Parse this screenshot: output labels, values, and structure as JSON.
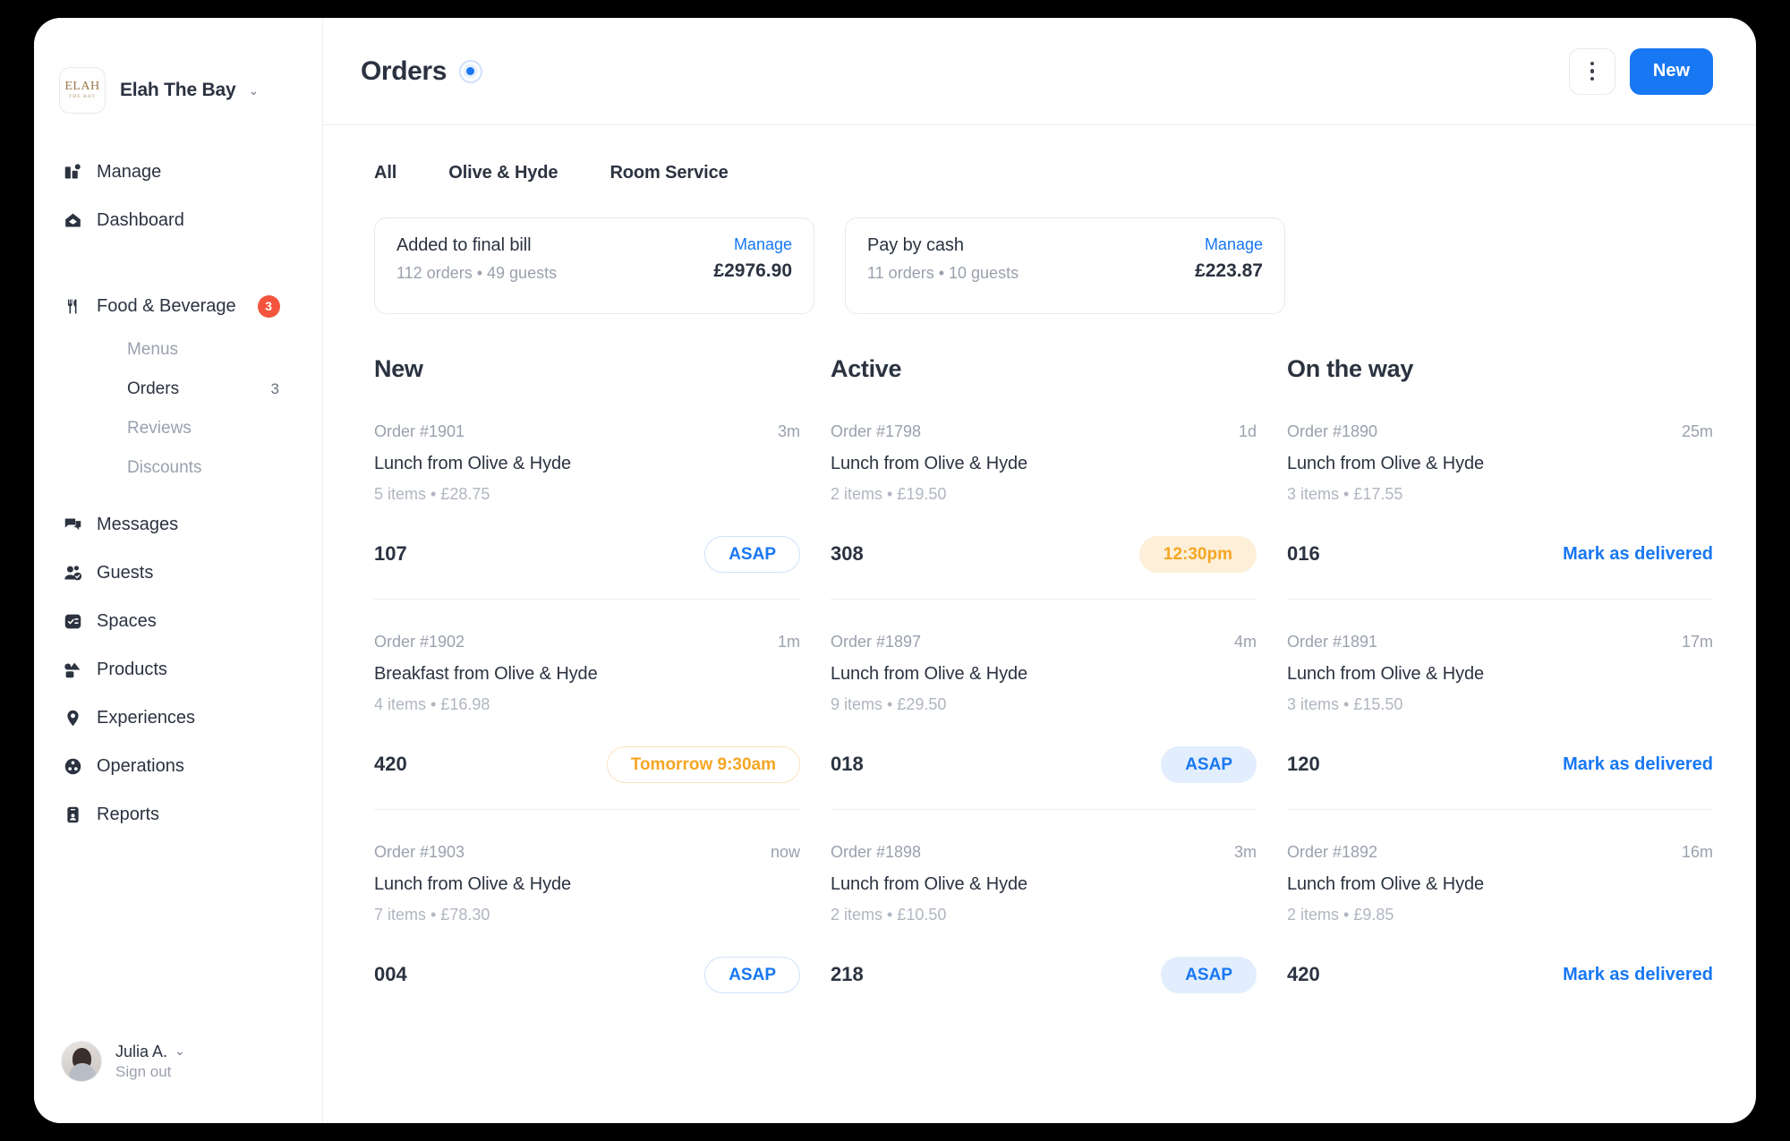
{
  "brand": {
    "logo_line1": "ELAH",
    "logo_line2": "THE BAY",
    "name": "Elah The Bay",
    "chevron": "⌄"
  },
  "sidebar": {
    "items": [
      {
        "label": "Manage",
        "icon": "manage-icon"
      },
      {
        "label": "Dashboard",
        "icon": "home-icon"
      }
    ],
    "food_beverage": {
      "label": "Food & Beverage",
      "icon": "cutlery-icon",
      "badge": "3"
    },
    "sub_items": [
      {
        "label": "Menus",
        "count": ""
      },
      {
        "label": "Orders",
        "count": "3"
      },
      {
        "label": "Reviews",
        "count": ""
      },
      {
        "label": "Discounts",
        "count": ""
      }
    ],
    "lower_items": [
      {
        "label": "Messages",
        "icon": "chat-icon"
      },
      {
        "label": "Guests",
        "icon": "users-check-icon"
      },
      {
        "label": "Spaces",
        "icon": "spaces-icon"
      },
      {
        "label": "Products",
        "icon": "products-icon"
      },
      {
        "label": "Experiences",
        "icon": "map-pin-icon"
      },
      {
        "label": "Operations",
        "icon": "operations-icon"
      },
      {
        "label": "Reports",
        "icon": "reports-icon"
      }
    ],
    "user": {
      "name": "Julia A.",
      "sign_out": "Sign out",
      "chevron": "⌄"
    }
  },
  "header": {
    "title": "Orders",
    "live_indicator": "live-status-dot",
    "kebab": "more-options",
    "new_button": "New"
  },
  "tabs": [
    {
      "label": "All"
    },
    {
      "label": "Olive & Hyde"
    },
    {
      "label": "Room Service"
    }
  ],
  "summary_cards": [
    {
      "title": "Added to final bill",
      "meta": "112 orders • 49 guests",
      "link": "Manage",
      "amount": "£2976.90"
    },
    {
      "title": "Pay by cash",
      "meta": "11 orders • 10 guests",
      "link": "Manage",
      "amount": "£223.87"
    }
  ],
  "columns": [
    {
      "title": "New",
      "orders": [
        {
          "order_id": "Order #1901",
          "time_ago": "3m",
          "title": "Lunch from Olive & Hyde",
          "meta": "5 items • £28.75",
          "room": "107",
          "action_label": "ASAP",
          "action_style": "outline-blue"
        },
        {
          "order_id": "Order #1902",
          "time_ago": "1m",
          "title": "Breakfast from Olive & Hyde",
          "meta": "4 items • £16.98",
          "room": "420",
          "action_label": "Tomorrow 9:30am",
          "action_style": "outline-orange"
        },
        {
          "order_id": "Order #1903",
          "time_ago": "now",
          "title": "Lunch from Olive & Hyde",
          "meta": "7 items • £78.30",
          "room": "004",
          "action_label": "ASAP",
          "action_style": "outline-blue"
        }
      ]
    },
    {
      "title": "Active",
      "orders": [
        {
          "order_id": "Order #1798",
          "time_ago": "1d",
          "title": "Lunch from Olive & Hyde",
          "meta": "2 items • £19.50",
          "room": "308",
          "action_label": "12:30pm",
          "action_style": "fill-orange"
        },
        {
          "order_id": "Order #1897",
          "time_ago": "4m",
          "title": "Lunch from Olive & Hyde",
          "meta": "9 items • £29.50",
          "room": "018",
          "action_label": "ASAP",
          "action_style": "fill-blue"
        },
        {
          "order_id": "Order #1898",
          "time_ago": "3m",
          "title": "Lunch from Olive & Hyde",
          "meta": "2 items • £10.50",
          "room": "218",
          "action_label": "ASAP",
          "action_style": "fill-blue"
        }
      ]
    },
    {
      "title": "On the way",
      "orders": [
        {
          "order_id": "Order #1890",
          "time_ago": "25m",
          "title": "Lunch from Olive & Hyde",
          "meta": "3 items • £17.55",
          "room": "016",
          "action_label": "Mark as delivered",
          "action_style": "link"
        },
        {
          "order_id": "Order #1891",
          "time_ago": "17m",
          "title": "Lunch from Olive & Hyde",
          "meta": "3 items • £15.50",
          "room": "120",
          "action_label": "Mark as delivered",
          "action_style": "link"
        },
        {
          "order_id": "Order #1892",
          "time_ago": "16m",
          "title": "Lunch from Olive & Hyde",
          "meta": "2 items • £9.85",
          "room": "420",
          "action_label": "Mark as delivered",
          "action_style": "link"
        }
      ]
    }
  ],
  "colors": {
    "accent_blue": "#1877f2",
    "badge_red": "#f4543c",
    "orange": "#f5a623",
    "text_dark": "#2b3240",
    "text_muted": "#9aa1ad"
  }
}
